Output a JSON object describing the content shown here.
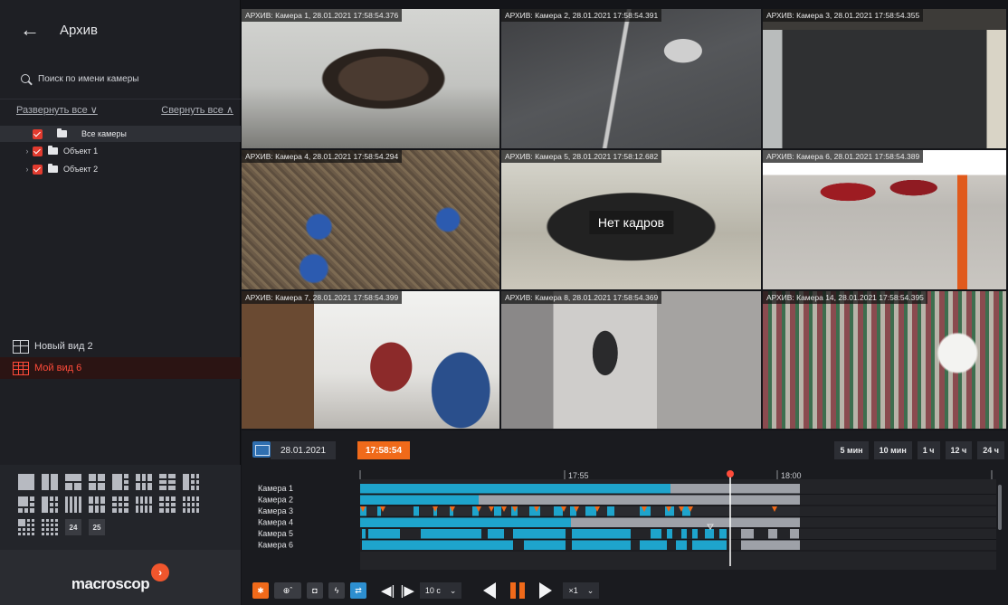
{
  "sidebar": {
    "title": "Архив",
    "search_placeholder": "Поиск по имени камеры",
    "expand_all": "Развернуть все ∨",
    "collapse_all": "Свернуть все ∧",
    "tree": [
      {
        "label": "Все камеры"
      },
      {
        "label": "Объект 1"
      },
      {
        "label": "Объект 2"
      }
    ],
    "views": [
      {
        "label": "Новый вид 2"
      },
      {
        "label": "Мой вид 6"
      }
    ],
    "layout_numbers": [
      "24",
      "25"
    ],
    "logo_text": "macroscop",
    "logo_mark": "›"
  },
  "cameras": [
    {
      "label": "АРХИВ: Камера 1, 28.01.2021 17:58:54.376"
    },
    {
      "label": "АРХИВ: Камера 2, 28.01.2021 17:58:54.391"
    },
    {
      "label": "АРХИВ: Камера 3, 28.01.2021 17:58:54.355"
    },
    {
      "label": "АРХИВ: Камера 4, 28.01.2021 17:58:54.294"
    },
    {
      "label": "АРХИВ: Камера 5, 28.01.2021 17:58:12.682",
      "no_frames": "Нет кадров"
    },
    {
      "label": "АРХИВ: Камера 6, 28.01.2021 17:58:54.389"
    },
    {
      "label": "АРХИВ: Камера 7, 28.01.2021 17:58:54.399"
    },
    {
      "label": "АРХИВ: Камера 8, 28.01.2021 17:58:54.369"
    },
    {
      "label": "АРХИВ: Камера 14, 28.01.2021 17:58:54.395"
    }
  ],
  "timeline": {
    "date": "28.01.2021",
    "time": "17:58:54",
    "zoom_options": [
      "5 мин",
      "10 мин",
      "1 ч",
      "12 ч",
      "24 ч"
    ],
    "tick_labels": [
      "17:55",
      "18:00"
    ],
    "rows": [
      "Камера 1",
      "Камера 2",
      "Камера 3",
      "Камера 4",
      "Камера 5",
      "Камера 6"
    ],
    "step": "10 с",
    "speed": "×1"
  },
  "colors": {
    "accent": "#f06a1a",
    "alert": "#ff4b3a",
    "recording": "#1ea4cc",
    "archive_gray": "#9ea1a8",
    "motion_marker": "#f06a1a"
  }
}
